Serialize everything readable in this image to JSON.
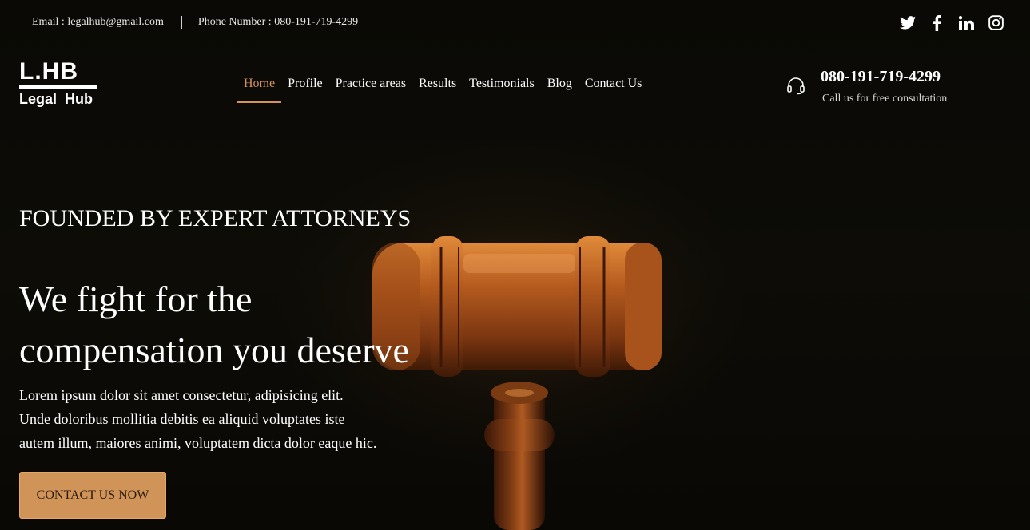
{
  "topbar": {
    "email": "Email : legalhub@gmail.com",
    "phone": "Phone Number : 080-191-719-4299"
  },
  "social": [
    "twitter-icon",
    "facebook-icon",
    "linkedin-icon",
    "instagram-icon"
  ],
  "logo": {
    "mark": "L.HB",
    "name": "Legal  Hub"
  },
  "nav": {
    "items": [
      "Home",
      "Profile",
      "Practice areas",
      "Results",
      "Testimonials",
      "Blog",
      "Contact Us"
    ],
    "active": "Home"
  },
  "call": {
    "number": "080-191-719-4299",
    "note": "Call us for free consultation"
  },
  "hero": {
    "eyebrow": "FOUNDED BY EXPERT ATTORNEYS",
    "headline_line1": "We fight for the",
    "headline_line2": "compensation you deserve",
    "desc_line1": "Lorem ipsum dolor sit amet consectetur, adipisicing elit.",
    "desc_line2": "Unde doloribus mollitia debitis ea aliquid voluptates iste",
    "desc_line3": "autem illum, maiores animi, voluptatem dicta dolor eaque hic.",
    "cta": "CONTACT US NOW"
  },
  "colors": {
    "accent": "#d4935a",
    "button": "#d19458",
    "background": "#0b0a06"
  }
}
